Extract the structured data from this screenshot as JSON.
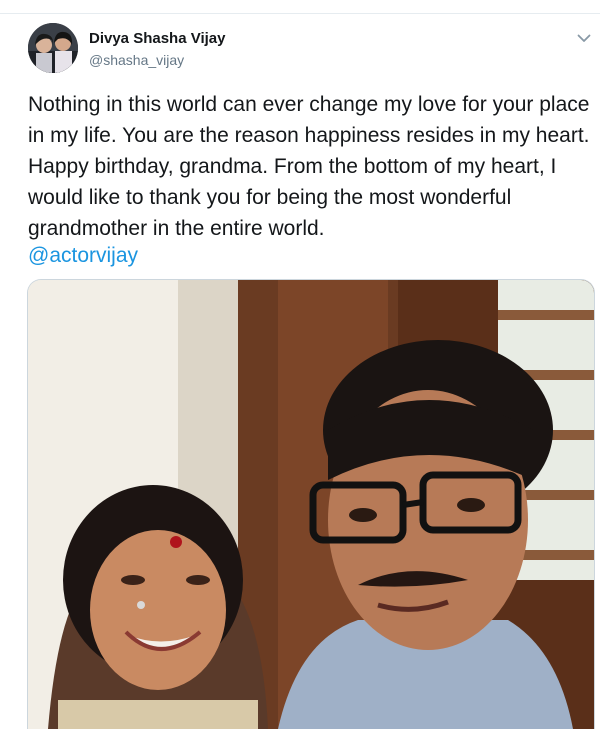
{
  "tweet": {
    "author": {
      "display_name": "Divya Shasha Vijay",
      "handle": "@shasha_vijay",
      "avatar_icon": "profile-avatar"
    },
    "text": "Nothing in this world can ever change my love for your place in my life. You are the reason happiness resides in my heart. Happy birthday, grandma. From the bottom of my heart, I would like to thank you for being the most wonderful grandmother in the entire world.",
    "mention": "@actorvijay",
    "menu_icon": "chevron-down-icon",
    "colors": {
      "text": "#14171a",
      "secondary": "#657786",
      "link": "#1b95e0"
    }
  }
}
